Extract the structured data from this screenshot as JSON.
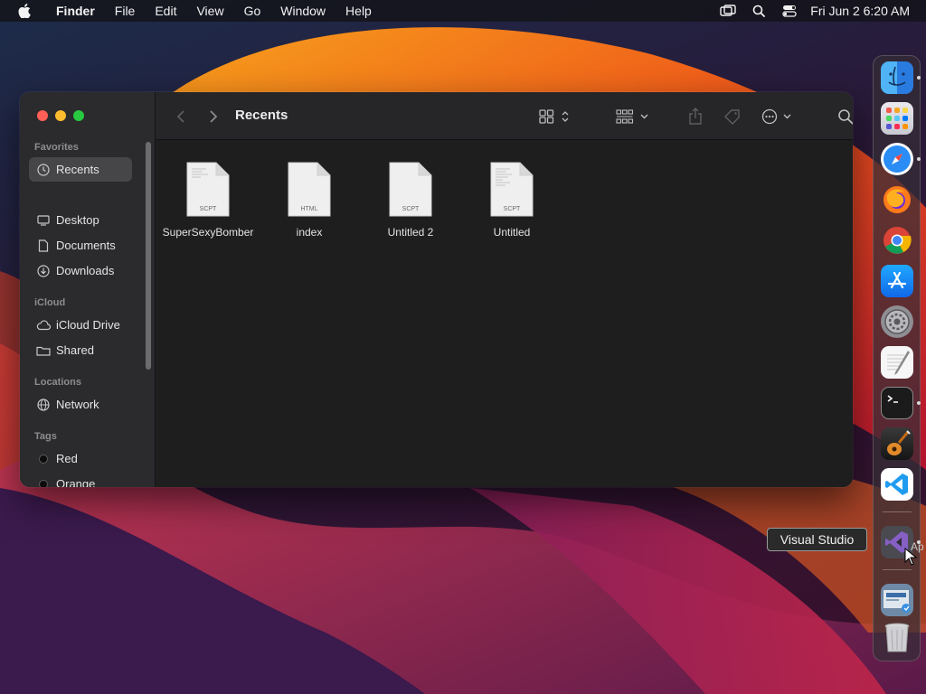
{
  "menubar": {
    "app_name": "Finder",
    "items": [
      "File",
      "Edit",
      "View",
      "Go",
      "Window",
      "Help"
    ],
    "clock": "Fri Jun 2  6:20 AM",
    "status_icons": [
      "screen-mirroring-icon",
      "spotlight-icon",
      "control-center-icon"
    ]
  },
  "finder": {
    "title": "Recents",
    "sidebar": {
      "favorites_label": "Favorites",
      "favorites": [
        {
          "label": "Recents",
          "icon": "clock-icon",
          "selected": true
        },
        {
          "label": "Desktop",
          "icon": "desktop-icon"
        },
        {
          "label": "Documents",
          "icon": "document-icon"
        },
        {
          "label": "Downloads",
          "icon": "download-icon"
        }
      ],
      "icloud_label": "iCloud",
      "icloud": [
        {
          "label": "iCloud Drive",
          "icon": "cloud-icon"
        },
        {
          "label": "Shared",
          "icon": "shared-folder-icon"
        }
      ],
      "locations_label": "Locations",
      "locations": [
        {
          "label": "Network",
          "icon": "globe-icon"
        }
      ],
      "tags_label": "Tags",
      "tags": [
        {
          "label": "Red"
        },
        {
          "label": "Orange"
        }
      ]
    },
    "files": [
      {
        "name": "SuperSexyBomber",
        "type": "SCPT"
      },
      {
        "name": "index",
        "type": "HTML"
      },
      {
        "name": "Untitled 2",
        "type": "SCPT"
      },
      {
        "name": "Untitled",
        "type": "SCPT"
      }
    ]
  },
  "dock": {
    "apps": [
      "Finder",
      "Launchpad",
      "Safari",
      "Firefox",
      "Google Chrome",
      "App Store",
      "System Settings",
      "TextEdit",
      "Terminal",
      "GarageBand",
      "Visual Studio Code",
      "Visual Studio",
      "Downloads",
      "Trash"
    ],
    "tooltip": "Visual Studio",
    "tooltip_overflow_text": "Ap"
  },
  "colors": {
    "accent_close": "#ff5f57",
    "accent_min": "#febc2e",
    "accent_max": "#28c840",
    "window_bg": "#1e1e1e",
    "sidebar_bg": "#2b2a2d"
  }
}
